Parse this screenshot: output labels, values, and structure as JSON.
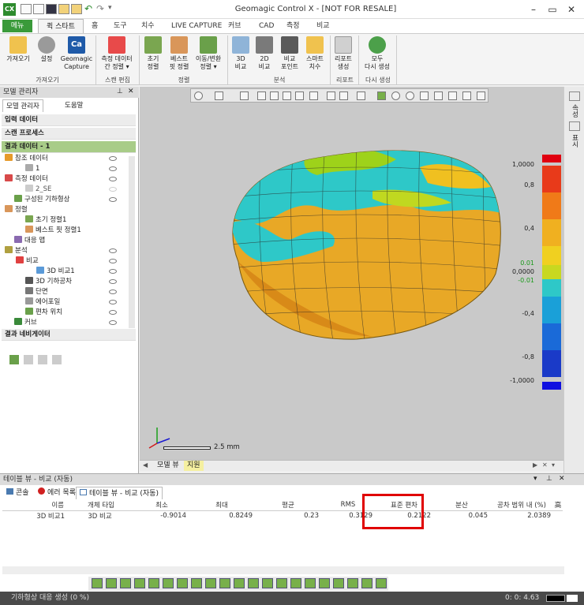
{
  "window": {
    "title": "Geomagic Control X - [NOT FOR RESALE]",
    "app_icon": "CX",
    "controls": [
      "–",
      "▭",
      "✕"
    ]
  },
  "ribbon": {
    "menu_label": "메뉴",
    "tabs": [
      "퀵 스타트",
      "홈",
      "도구",
      "치수",
      "LIVE CAPTURE",
      "커브",
      "CAD",
      "측정",
      "비교"
    ],
    "buttons": {
      "import": "가져오기",
      "settings": "설정",
      "capture_1": "Geomagic",
      "capture_2": "Capture",
      "scan_edit_1": "측정 데이터",
      "scan_edit_2": "간 정렬 ▾",
      "init_align_1": "초기",
      "init_align_2": "정렬",
      "best_fit_1": "베스트",
      "best_fit_2": "핏 정렬",
      "transform_1": "이동/변환",
      "transform_2": "정렬 ▾",
      "cmp3d_1": "3D",
      "cmp3d_2": "비교",
      "cmp2d_1": "2D",
      "cmp2d_2": "비교",
      "cmp_point_1": "비교",
      "cmp_point_2": "포인트",
      "smart_dim_1": "스마트",
      "smart_dim_2": "치수",
      "report_1": "리포트",
      "report_2": "생성",
      "regen_1": "모두",
      "regen_2": "다시 생성"
    },
    "groups": [
      "가져오기",
      "스캔 편집",
      "정렬",
      "분석",
      "리포트",
      "다시 생성"
    ]
  },
  "model_manager": {
    "title": "모델 관리자",
    "tabs": [
      "모델 관리자",
      "도움말"
    ],
    "sections": {
      "input": "입력 데이터",
      "scan": "스캔 프로세스",
      "result": "결과 데이터 - 1",
      "nav": "결과 네비게이터"
    },
    "tree": [
      {
        "label": "참조 데이터"
      },
      {
        "label": "1"
      },
      {
        "label": "측정 데이터"
      },
      {
        "label": "2_SE"
      },
      {
        "label": "구성된 기하형상"
      },
      {
        "label": "정렬"
      },
      {
        "label": "초기 정렬1"
      },
      {
        "label": "베스트 핏 정렬1"
      },
      {
        "label": "대응 맵"
      },
      {
        "label": "분석"
      },
      {
        "label": "비교"
      },
      {
        "label": "3D 비교1"
      },
      {
        "label": "3D 기하공차"
      },
      {
        "label": "단면"
      },
      {
        "label": "에어포일"
      },
      {
        "label": "편차 위치"
      },
      {
        "label": "커브"
      }
    ]
  },
  "viewport": {
    "scale_label": "2.5 mm",
    "colorbar_labels": [
      "1,0000",
      "0,8",
      "0,4",
      "0.01",
      "0,0000",
      "-0.01",
      "-0,4",
      "-0,8",
      "-1,0000"
    ],
    "tabs": [
      "모델 뷰",
      "지원"
    ]
  },
  "right_tabs": [
    "속성",
    "표시"
  ],
  "table_view": {
    "title": "테이블 뷰 - 비교 (자동)",
    "tabs": [
      "콘솔",
      "에러 목록",
      "테이블 뷰 - 비교 (자동)"
    ],
    "columns": [
      "이름",
      "개체 타입",
      "최소",
      "최대",
      "평균",
      "RMS",
      "표준 편차",
      "분산",
      "공차 범위 내 (%)",
      "高"
    ],
    "rows": [
      [
        "3D 비교1",
        "3D 비교",
        "-0.9014",
        "0.8249",
        "0.23",
        "0.3129",
        "0.2122",
        "0.045",
        "2.0389",
        ""
      ]
    ]
  },
  "status": {
    "left": "기하형상 대응 생성 (0 %)",
    "right": "0: 0: 4.63"
  }
}
